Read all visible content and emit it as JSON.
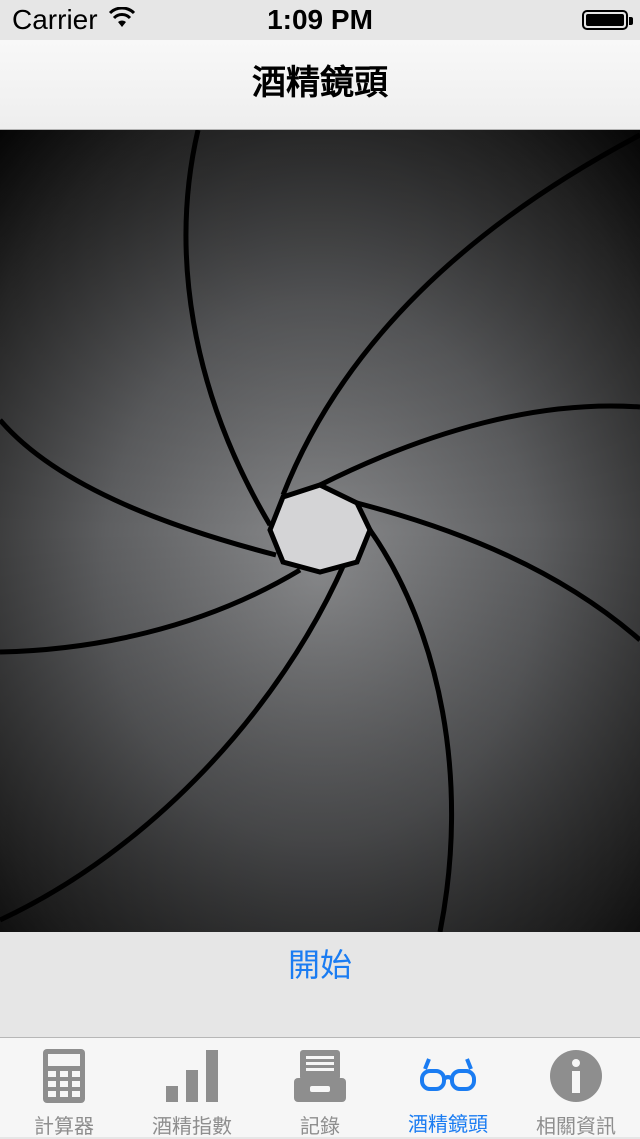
{
  "status_bar": {
    "carrier": "Carrier",
    "time": "1:09 PM"
  },
  "nav": {
    "title": "酒精鏡頭"
  },
  "controls": {
    "start_label": "開始"
  },
  "tabs": [
    {
      "label": "計算器",
      "icon": "calculator-icon",
      "active": false
    },
    {
      "label": "酒精指數",
      "icon": "bar-chart-icon",
      "active": false
    },
    {
      "label": "記錄",
      "icon": "file-cabinet-icon",
      "active": false
    },
    {
      "label": "酒精鏡頭",
      "icon": "glasses-icon",
      "active": true
    },
    {
      "label": "相關資訊",
      "icon": "info-icon",
      "active": false
    }
  ],
  "colors": {
    "accent": "#1a7cf2",
    "inactive": "#8e8e8e"
  }
}
